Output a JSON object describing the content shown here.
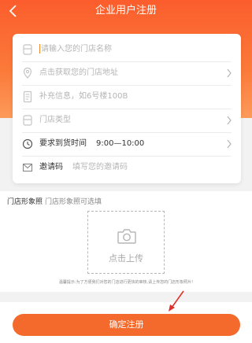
{
  "header": {
    "title": "企业用户注册",
    "back_icon": "back-chevron-icon",
    "background": "#fb6a30"
  },
  "form": {
    "store_name": {
      "placeholder": "请输入您的门店名称",
      "icon": "store-icon"
    },
    "store_address": {
      "placeholder": "点击获取您的门店地址",
      "icon": "location-pin-icon"
    },
    "address_supplement": {
      "placeholder": "补充信息，如6号楼100B",
      "icon": "document-icon"
    },
    "store_type": {
      "placeholder": "门店类型",
      "icon": "store-type-icon"
    },
    "delivery_time": {
      "label": "要求到货时间",
      "value": "9:00—10:00",
      "icon": "clock-icon"
    },
    "invite_code": {
      "label": "邀请码",
      "placeholder": "填写您的邀请码",
      "icon": "envelope-icon"
    }
  },
  "photo": {
    "title": "门店形象照",
    "optional_note": "门店形象照可选填",
    "upload_label": "点击上传",
    "upload_icon": "camera-icon",
    "notice": "温馨提示:为了方便我们对您的门店进行更快的审核,请上传您的门店形象照片!"
  },
  "submit": {
    "label": "确定注册",
    "color": "#f46a2c"
  },
  "annotation": {
    "icon": "red-arrow-icon",
    "color": "#e0302a"
  }
}
